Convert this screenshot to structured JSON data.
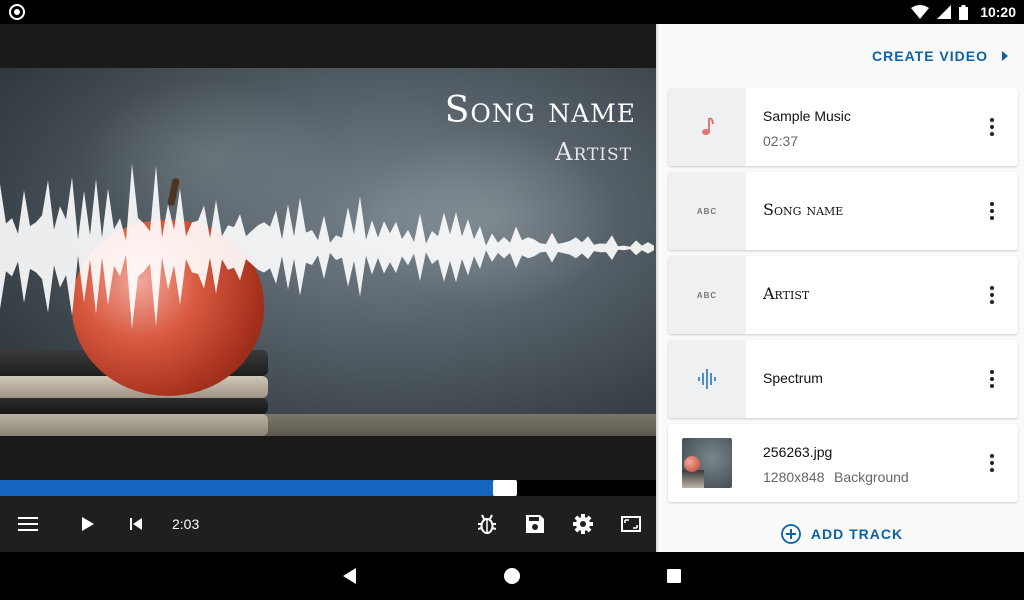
{
  "status": {
    "time": "10:20"
  },
  "preview": {
    "song_title": "Song name",
    "artist_title": "Artist"
  },
  "player": {
    "time": "2:03",
    "progress": 0.77
  },
  "panel": {
    "create_video_label": "CREATE VIDEO",
    "add_track_label": "ADD TRACK",
    "tracks": [
      {
        "title": "Sample Music",
        "subtitle": "02:37",
        "icon": "music-note-icon"
      },
      {
        "title": "Song name",
        "icon": "text-abc-icon",
        "thumb_text": "ABC"
      },
      {
        "title": "Artist",
        "icon": "text-abc-icon",
        "thumb_text": "ABC"
      },
      {
        "title": "Spectrum",
        "icon": "spectrum-icon"
      },
      {
        "title": "256263.jpg",
        "subtitle": "1280x848",
        "subtitle2": "Background",
        "icon": "image-thumbnail"
      }
    ]
  },
  "colors": {
    "accent": "#0d61a6",
    "progress": "#1565c0",
    "music_icon": "#e57373",
    "spectrum_icon": "#4a90c8"
  }
}
